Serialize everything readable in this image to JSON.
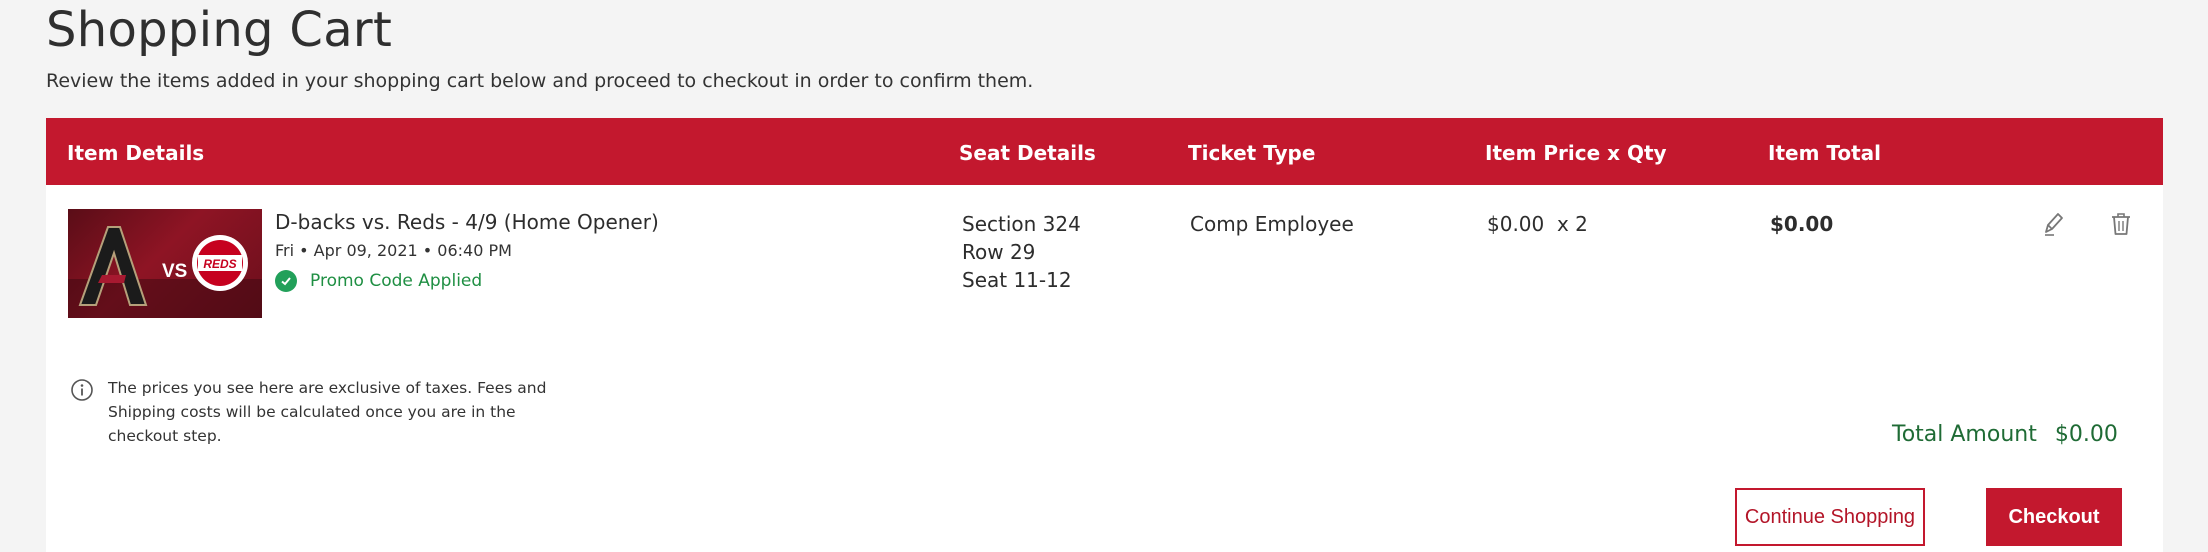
{
  "page": {
    "title": "Shopping Cart",
    "subtitle": "Review the items added in your shopping cart below and proceed to checkout in order to confirm them."
  },
  "table": {
    "headers": {
      "item_details": "Item Details",
      "seat_details": "Seat Details",
      "ticket_type": "Ticket Type",
      "price_qty": "Item Price x Qty",
      "item_total": "Item Total"
    }
  },
  "item": {
    "name": "D-backs vs. Reds - 4/9 (Home Opener)",
    "date": "Fri • Apr 09, 2021 • 06:40 PM",
    "promo": "Promo Code Applied",
    "thumbnail_vs": "VS",
    "thumbnail_reds": "REDS",
    "seat": {
      "section": "Section 324",
      "row": "Row 29",
      "seat": "Seat 11-12"
    },
    "ticket_type": "Comp Employee",
    "price_qty": "$0.00  x 2",
    "total": "$0.00",
    "icons": {
      "edit": "pencil-icon",
      "delete": "trash-icon"
    }
  },
  "info": {
    "icon": "info-icon",
    "text_line1": "The prices you see here are exclusive of taxes. Fees and",
    "text_line2": "Shipping costs will be calculated once you are in the",
    "text_line3": "checkout step."
  },
  "summary": {
    "total_label": "Total Amount",
    "total_value": "$0.00"
  },
  "buttons": {
    "continue": "Continue Shopping",
    "checkout": "Checkout"
  },
  "colors": {
    "brand_red": "#c3182e",
    "promo_green": "#22a05a",
    "total_green": "#1f6b35"
  }
}
